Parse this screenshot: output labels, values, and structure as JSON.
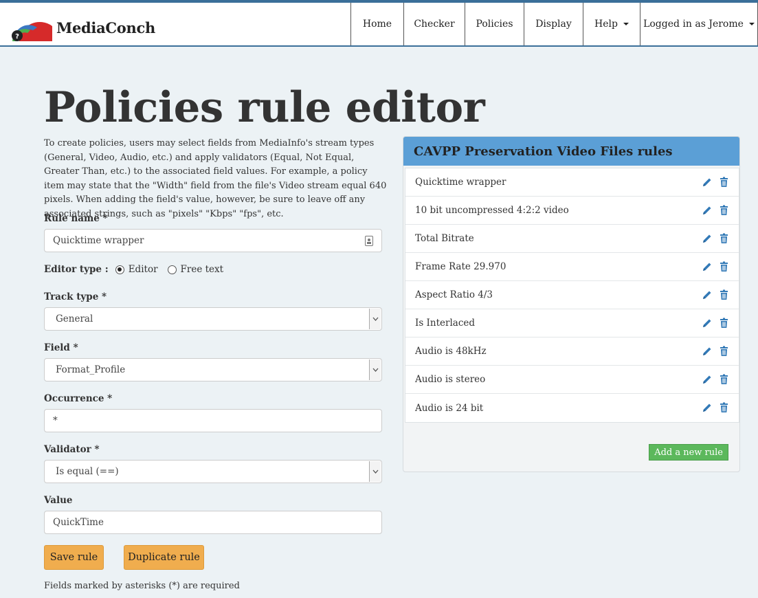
{
  "brand": {
    "name": "MediaConch"
  },
  "nav": {
    "items": [
      {
        "label": "Home",
        "dropdown": false
      },
      {
        "label": "Checker",
        "dropdown": false
      },
      {
        "label": "Policies",
        "dropdown": false
      },
      {
        "label": "Display",
        "dropdown": false
      },
      {
        "label": "Help",
        "dropdown": true
      },
      {
        "label": "Logged in as Jerome",
        "dropdown": true
      }
    ]
  },
  "page": {
    "title": "Policies rule editor",
    "intro": "To create policies, users may select fields from MediaInfo's stream types (General, Video, Audio, etc.) and apply validators (Equal, Not Equal, Greater Than, etc.) to the associated field values. For example, a policy item may state that the \"Width\" field from the file's Video stream equal 640 pixels. When adding the field's value, however, be sure to leave off any associated strings, such as \"pixels\" \"Kbps\" \"fps\", etc."
  },
  "form": {
    "rule_name": {
      "label": "Rule name *",
      "value": "Quicktime wrapper"
    },
    "editor_type": {
      "label": "Editor type :",
      "options": [
        "Editor",
        "Free text"
      ],
      "selected": "Editor"
    },
    "track_type": {
      "label": "Track type *",
      "value": "General"
    },
    "field": {
      "label": "Field *",
      "value": "Format_Profile"
    },
    "occurrence": {
      "label": "Occurrence *",
      "value": "*"
    },
    "validator": {
      "label": "Validator *",
      "value": "Is equal (==)"
    },
    "value": {
      "label": "Value",
      "value": "QuickTime"
    },
    "save_label": "Save rule",
    "duplicate_label": "Duplicate rule",
    "footnote": "Fields marked by asterisks (*) are required"
  },
  "rules_panel": {
    "title": "CAVPP Preservation Video Files rules",
    "rules": [
      "Quicktime wrapper",
      "10 bit uncompressed 4:2:2 video",
      "Total Bitrate",
      "Frame Rate 29.970",
      "Aspect Ratio 4/3",
      "Is Interlaced",
      "Audio is 48kHz",
      "Audio is stereo",
      "Audio is 24 bit"
    ],
    "add_label": "Add a new rule"
  },
  "colors": {
    "navbar_border": "#3b6f99",
    "panel_header": "#5b9fd6",
    "action_icons": "#337ab7",
    "button_orange": "#f0ad4e",
    "button_green": "#5cb85c",
    "background": "#ecf2f5"
  },
  "icons": {
    "logo": "mediaconch-logo",
    "edit": "pencil-icon",
    "delete": "trash-icon",
    "select": "chevron-down-icon",
    "contact": "contact-card-icon"
  }
}
